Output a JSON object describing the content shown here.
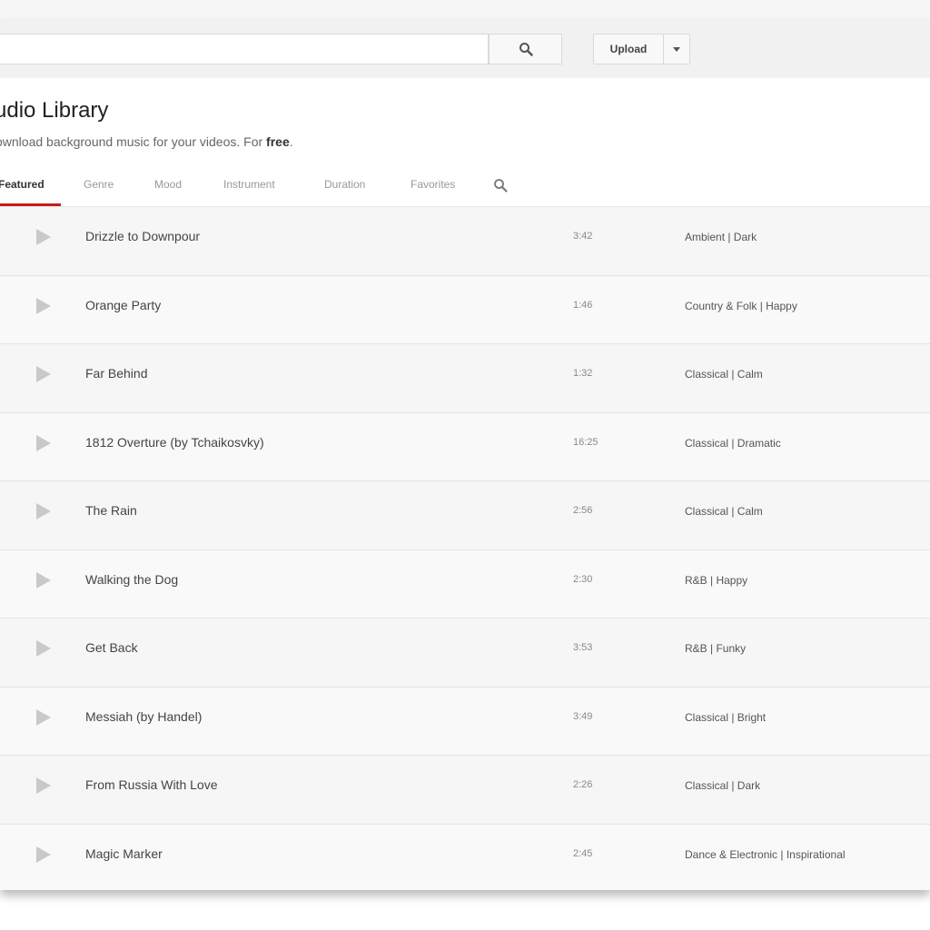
{
  "header": {
    "search": {
      "value": "",
      "placeholder": ""
    },
    "search_icon": "search-icon",
    "upload_label": "Upload",
    "upload_menu_icon": "chevron-down-icon"
  },
  "page": {
    "title": "udio Library",
    "subtitle_prefix": "ownload background music for your videos. For ",
    "subtitle_bold": "free",
    "subtitle_suffix": "."
  },
  "tabs": [
    {
      "label": "Featured",
      "active": true
    },
    {
      "label": "Genre",
      "active": false
    },
    {
      "label": "Mood",
      "active": false
    },
    {
      "label": "Instrument",
      "active": false
    },
    {
      "label": "Duration",
      "active": false
    },
    {
      "label": "Favorites",
      "active": false
    }
  ],
  "accent_color": "#cc181e",
  "tracks": [
    {
      "title": "Drizzle to Downpour",
      "duration": "3:42",
      "tags": "Ambient | Dark"
    },
    {
      "title": "Orange Party",
      "duration": "1:46",
      "tags": "Country & Folk | Happy"
    },
    {
      "title": "Far Behind",
      "duration": "1:32",
      "tags": "Classical | Calm"
    },
    {
      "title": "1812 Overture (by Tchaikosvky)",
      "duration": "16:25",
      "tags": "Classical | Dramatic"
    },
    {
      "title": "The Rain",
      "duration": "2:56",
      "tags": "Classical | Calm"
    },
    {
      "title": "Walking the Dog",
      "duration": "2:30",
      "tags": "R&B | Happy"
    },
    {
      "title": "Get Back",
      "duration": "3:53",
      "tags": "R&B | Funky"
    },
    {
      "title": "Messiah (by Handel)",
      "duration": "3:49",
      "tags": "Classical | Bright"
    },
    {
      "title": "From Russia With Love",
      "duration": "2:26",
      "tags": "Classical | Dark"
    },
    {
      "title": "Magic Marker",
      "duration": "2:45",
      "tags": "Dance & Electronic | Inspirational"
    }
  ]
}
